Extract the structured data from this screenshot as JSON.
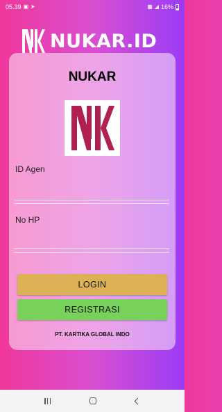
{
  "status_bar": {
    "time": "05.39",
    "battery": "16%"
  },
  "brand": {
    "name": "NUKAR.ID"
  },
  "card": {
    "title": "NUKAR",
    "fields": [
      {
        "label": "ID Agen",
        "value": "",
        "placeholder": ""
      },
      {
        "label": "No HP",
        "value": "",
        "placeholder": ""
      }
    ],
    "buttons": {
      "login": "LOGIN",
      "register": "REGISTRASI"
    },
    "footer": "PT. KARTIKA GLOBAL INDO"
  },
  "colors": {
    "gradient_left": "#f0379a",
    "gradient_right": "#9a3cf6",
    "login_button": "#dcb255",
    "register_button": "#78d15a",
    "logo_crimson": "#b02050"
  }
}
